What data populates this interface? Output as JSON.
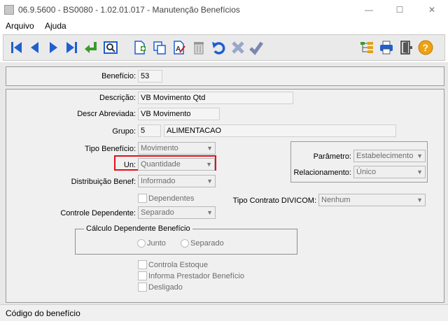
{
  "window": {
    "title": "06.9.5600 - BS0080 - 1.02.01.017 - Manutenção Benefícios",
    "minimize": "—",
    "maximize": "☐",
    "close": "✕"
  },
  "menu": [
    "Arquivo",
    "Ajuda"
  ],
  "toolbar": {
    "icons": [
      "first-record-icon",
      "previous-record-icon",
      "next-record-icon",
      "last-record-icon",
      "return-icon",
      "search-icon",
      "new-record-icon",
      "copy-icon",
      "edit-icon",
      "delete-icon",
      "undo-icon",
      "cancel-icon",
      "confirm-icon",
      "tree-icon",
      "print-icon",
      "exit-icon",
      "help-icon"
    ]
  },
  "form": {
    "beneficio": {
      "label": "Benefício:",
      "value": "53"
    },
    "descricao": {
      "label": "Descrição:",
      "value": "VB Movimento Qtd"
    },
    "descr_abreviada": {
      "label": "Descr Abreviada:",
      "value": "VB Movimento"
    },
    "grupo": {
      "label": "Grupo:",
      "code": "5",
      "name": "ALIMENTACAO"
    },
    "tipo_beneficio": {
      "label": "Tipo Benefício:",
      "value": "Movimento"
    },
    "un": {
      "label": "Un:",
      "value": "Quantidade"
    },
    "distribuicao": {
      "label": "Distribuição Benef:",
      "value": "Informado"
    },
    "dependentes": {
      "label": "Dependentes",
      "checked": false
    },
    "controle_dependente": {
      "label": "Controle Dependente:",
      "value": "Separado"
    },
    "parametro": {
      "label": "Parâmetro:",
      "value": "Estabelecimento"
    },
    "relacionamento": {
      "label": "Relacionamento:",
      "value": "Único"
    },
    "tipo_contrato": {
      "label": "Tipo Contrato DIVICOM:",
      "value": "Nenhum"
    },
    "calculo": {
      "legend": "Cálculo Dependente Benefício",
      "option_junto": "Junto",
      "option_separado": "Separado"
    },
    "controla_estoque": {
      "label": "Controla Estoque",
      "checked": false
    },
    "informa_prestador": {
      "label": "Informa Prestador Benefício",
      "checked": false
    },
    "desligado": {
      "label": "Desligado",
      "checked": false
    }
  },
  "status": {
    "text": "Código do benefício"
  },
  "colors": {
    "highlight": "#e0121a",
    "toolbar_blue": "#1f5fd0"
  }
}
